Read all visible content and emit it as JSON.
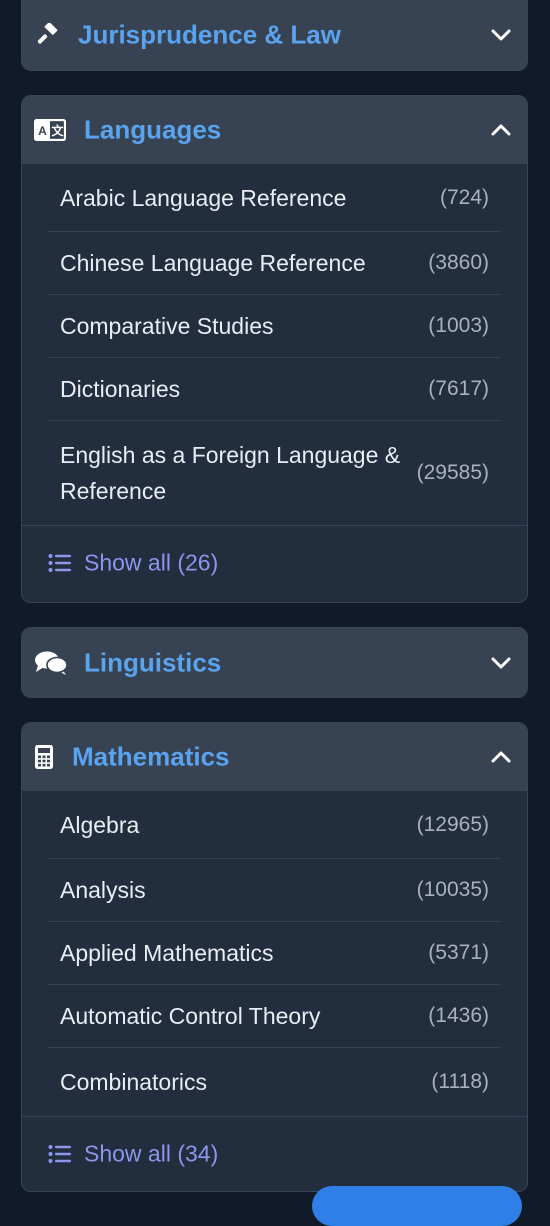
{
  "categories": [
    {
      "title": "Jurisprudence & Law",
      "icon": "gavel-icon",
      "expanded": false
    },
    {
      "title": "Languages",
      "icon": "translate-icon",
      "expanded": true,
      "items": [
        {
          "label": "Arabic Language Reference",
          "count": "(724)"
        },
        {
          "label": "Chinese Language Reference",
          "count": "(3860)"
        },
        {
          "label": "Comparative Studies",
          "count": "(1003)"
        },
        {
          "label": "Dictionaries",
          "count": "(7617)"
        },
        {
          "label": "English as a Foreign Language & Reference",
          "count": "(29585)"
        }
      ],
      "show_all": "Show all (26)"
    },
    {
      "title": "Linguistics",
      "icon": "chat-bubbles-icon",
      "expanded": false
    },
    {
      "title": "Mathematics",
      "icon": "calculator-icon",
      "expanded": true,
      "items": [
        {
          "label": "Algebra",
          "count": "(12965)"
        },
        {
          "label": "Analysis",
          "count": "(10035)"
        },
        {
          "label": "Applied Mathematics",
          "count": "(5371)"
        },
        {
          "label": "Automatic Control Theory",
          "count": "(1436)"
        },
        {
          "label": "Combinatorics",
          "count": "(1118)"
        }
      ],
      "show_all": "Show all (34)"
    }
  ],
  "colors": {
    "page_bg": "#111a28",
    "panel_bg": "#222d3d",
    "header_bg": "#374252",
    "accent_title": "#5aa3ef",
    "show_all": "#8b96ec",
    "fab": "#2f7fe6"
  }
}
